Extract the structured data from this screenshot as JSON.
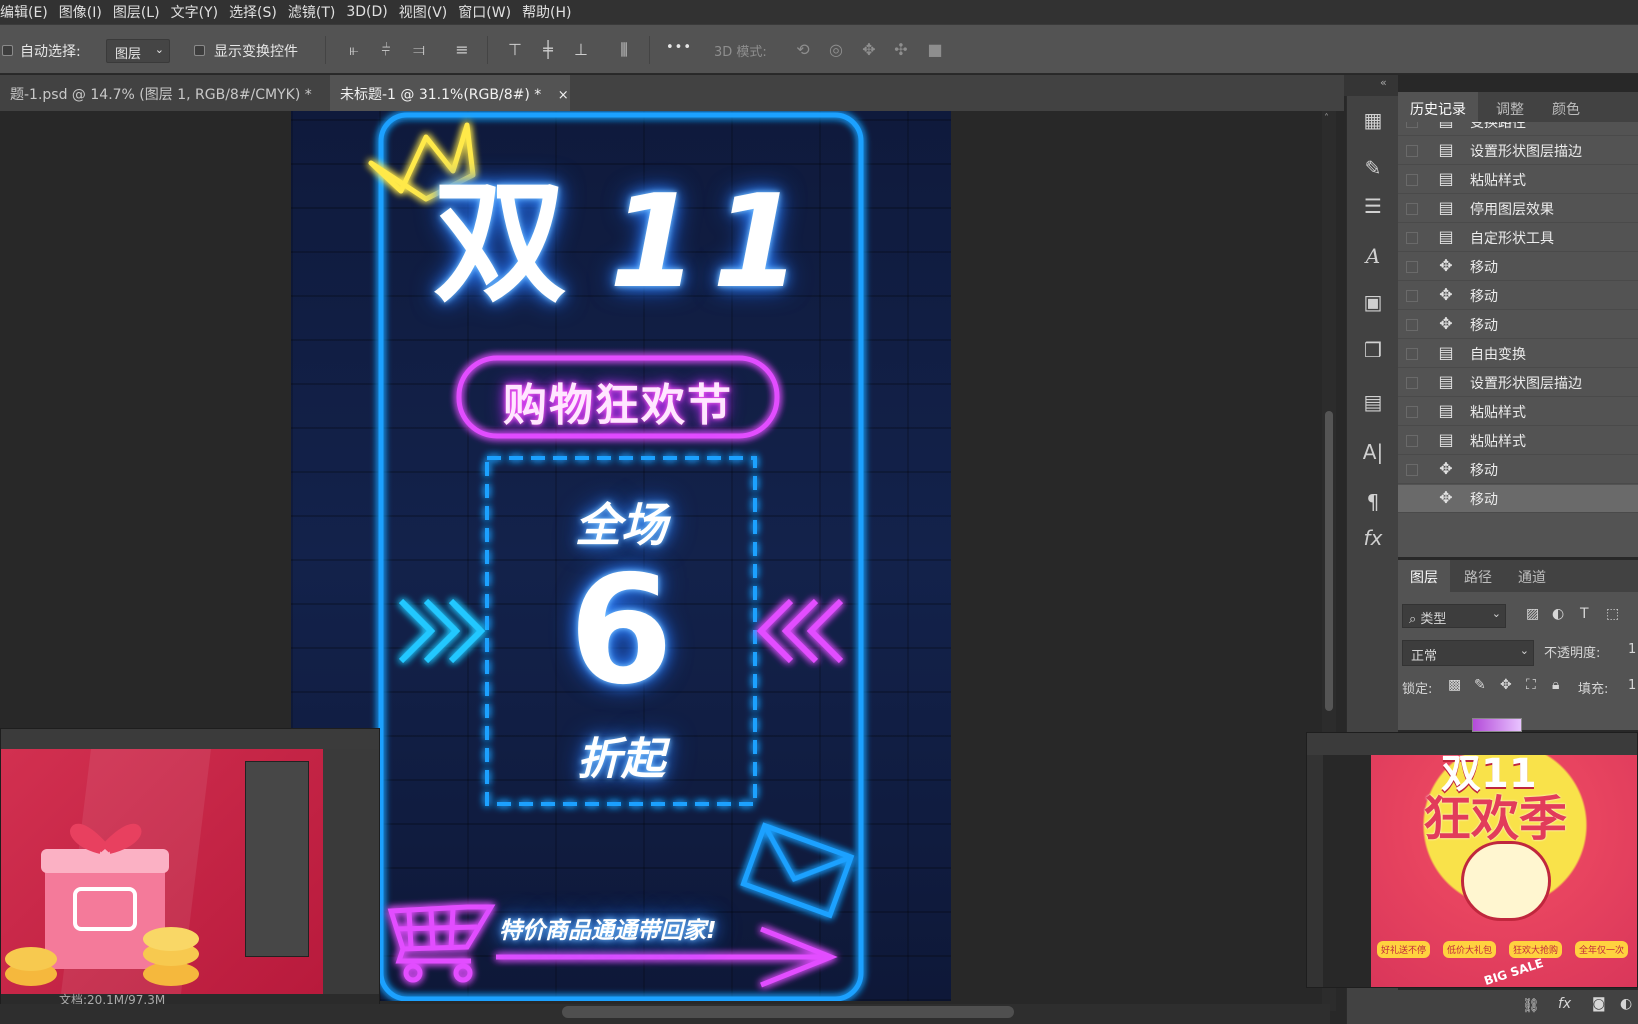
{
  "menu": [
    "编辑(E)",
    "图像(I)",
    "图层(L)",
    "文字(Y)",
    "选择(S)",
    "滤镜(T)",
    "3D(D)",
    "视图(V)",
    "窗口(W)",
    "帮助(H)"
  ],
  "options": {
    "auto_select_label": "自动选择:",
    "auto_select_value": "图层",
    "show_transform_label": "显示变换控件",
    "more_label": "•••",
    "mode_3d_label": "3D 模式:"
  },
  "tabs": [
    {
      "label": "题-1.psd @ 14.7% (图层 1, RGB/8#/CMYK) *",
      "active": false
    },
    {
      "label": "未标题-1 @ 31.1%(RGB/8#) *",
      "active": true
    }
  ],
  "tab_close": "×",
  "poster": {
    "title_double": "双",
    "title_11": "11",
    "subtitle": "购物狂欢节",
    "ticket_top": "全场",
    "ticket_number": "6",
    "ticket_bottom": "折起",
    "footer_text": "特价商品通通带回家!",
    "colors": {
      "neon_blue": "#1da1ff",
      "neon_pink": "#e24dff",
      "neon_yellow": "#ffe94a",
      "bg": "#13224b"
    }
  },
  "history": {
    "tabs": [
      "历史记录",
      "调整",
      "颜色"
    ],
    "items": [
      {
        "icon": "document-icon",
        "label": "变换路径"
      },
      {
        "icon": "document-icon",
        "label": "设置形状图层描边"
      },
      {
        "icon": "document-icon",
        "label": "粘贴样式"
      },
      {
        "icon": "document-icon",
        "label": "停用图层效果"
      },
      {
        "icon": "document-icon",
        "label": "自定形状工具"
      },
      {
        "icon": "move-icon",
        "label": "移动"
      },
      {
        "icon": "move-icon",
        "label": "移动"
      },
      {
        "icon": "move-icon",
        "label": "移动"
      },
      {
        "icon": "document-icon",
        "label": "自由变换"
      },
      {
        "icon": "document-icon",
        "label": "设置形状图层描边"
      },
      {
        "icon": "document-icon",
        "label": "粘贴样式"
      },
      {
        "icon": "document-icon",
        "label": "粘贴样式"
      },
      {
        "icon": "move-icon",
        "label": "移动"
      },
      {
        "icon": "move-icon",
        "label": "移动"
      }
    ]
  },
  "layers": {
    "tabs": [
      "图层",
      "路径",
      "通道"
    ],
    "filter_label": "类型",
    "blend_mode": "正常",
    "opacity_label": "不透明度:",
    "opacity_value": "1",
    "lock_label": "锁定:",
    "fill_label": "填充:",
    "fill_value": "1"
  },
  "thumb_left": {
    "status": "文档:20.1M/97.3M"
  },
  "thumb_right": {
    "title_top": "双11",
    "title_main": "狂欢季",
    "badge1": "好礼送不停",
    "badge2": "低价大礼包",
    "badge3": "狂欢大抢购",
    "badge4": "全年仅一次",
    "big_sale": "BIG SALE"
  }
}
